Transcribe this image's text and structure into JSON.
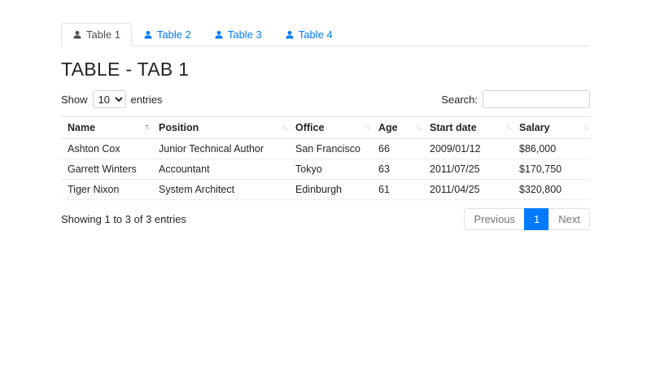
{
  "tabs": [
    {
      "label": "Table 1",
      "active": true
    },
    {
      "label": "Table 2",
      "active": false
    },
    {
      "label": "Table 3",
      "active": false
    },
    {
      "label": "Table 4",
      "active": false
    }
  ],
  "page_title": "TABLE - TAB 1",
  "controls": {
    "show_label": "Show",
    "entries_label": "entries",
    "page_length": "10",
    "search_label": "Search:",
    "search_value": ""
  },
  "icons": {
    "sort_asc": "↑",
    "sort_desc": "↓"
  },
  "table": {
    "columns": [
      "Name",
      "Position",
      "Office",
      "Age",
      "Start date",
      "Salary"
    ],
    "sorted_column": "Name",
    "sort_direction": "asc",
    "rows": [
      [
        "Ashton Cox",
        "Junior Technical Author",
        "San Francisco",
        "66",
        "2009/01/12",
        "$86,000"
      ],
      [
        "Garrett Winters",
        "Accountant",
        "Tokyo",
        "63",
        "2011/07/25",
        "$170,750"
      ],
      [
        "Tiger Nixon",
        "System Architect",
        "Edinburgh",
        "61",
        "2011/04/25",
        "$320,800"
      ]
    ]
  },
  "footer": {
    "info": "Showing 1 to 3 of 3 entries",
    "pagination": {
      "previous_label": "Previous",
      "current_page": "1",
      "next_label": "Next"
    }
  },
  "colors": {
    "accent": "#007bff",
    "border": "#dee2e6",
    "muted": "#6c757d"
  }
}
